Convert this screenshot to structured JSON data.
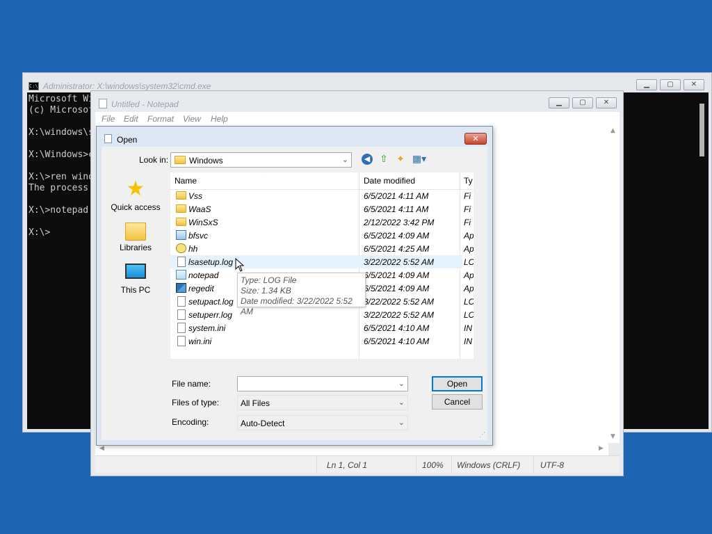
{
  "cmd": {
    "title": "Administrator: X:\\windows\\system32\\cmd.exe",
    "lines": [
      "Microsoft Wi",
      "(c) Microsof",
      "",
      "X:\\windows\\s",
      "",
      "X:\\Windows>c",
      "",
      "X:\\>ren wind",
      "The process",
      "",
      "X:\\>notepad",
      "",
      "X:\\>"
    ],
    "icon": "console-icon"
  },
  "notepad": {
    "title": "Untitled - Notepad",
    "menu": [
      "File",
      "Edit",
      "Format",
      "View",
      "Help"
    ],
    "status": {
      "position": "Ln 1, Col 1",
      "zoom": "100%",
      "line_ending": "Windows (CRLF)",
      "encoding": "UTF-8"
    }
  },
  "open_dialog": {
    "title": "Open",
    "look_in_label": "Look in:",
    "look_in_value": "Windows",
    "places": [
      {
        "label": "Quick access",
        "icon": "star-icon"
      },
      {
        "label": "Libraries",
        "icon": "libraries-folder-icon"
      },
      {
        "label": "This PC",
        "icon": "monitor-icon"
      }
    ],
    "columns": {
      "name": "Name",
      "date": "Date modified",
      "type": "Ty"
    },
    "files": [
      {
        "name": "Vss",
        "date": "6/5/2021 4:11 AM",
        "type": "Fi",
        "icon": "folder"
      },
      {
        "name": "WaaS",
        "date": "6/5/2021 4:11 AM",
        "type": "Fi",
        "icon": "folder"
      },
      {
        "name": "WinSxS",
        "date": "2/12/2022 3:42 PM",
        "type": "Fi",
        "icon": "folder"
      },
      {
        "name": "bfsvc",
        "date": "6/5/2021 4:09 AM",
        "type": "Ap",
        "icon": "app"
      },
      {
        "name": "hh",
        "date": "6/5/2021 4:25 AM",
        "type": "Ap",
        "icon": "help"
      },
      {
        "name": "lsasetup.log",
        "date": "3/22/2022 5:52 AM",
        "type": "LC",
        "icon": "doc"
      },
      {
        "name": "notepad",
        "date": "6/5/2021 4:09 AM",
        "type": "Ap",
        "icon": "notepad"
      },
      {
        "name": "regedit",
        "date": "6/5/2021 4:09 AM",
        "type": "Ap",
        "icon": "regedit"
      },
      {
        "name": "setupact.log",
        "date": "3/22/2022 5:52 AM",
        "type": "LC",
        "icon": "doc"
      },
      {
        "name": "setuperr.log",
        "date": "3/22/2022 5:52 AM",
        "type": "LC",
        "icon": "doc"
      },
      {
        "name": "system.ini",
        "date": "6/5/2021 4:10 AM",
        "type": "IN",
        "icon": "doc"
      },
      {
        "name": "win.ini",
        "date": "6/5/2021 4:10 AM",
        "type": "IN",
        "icon": "doc"
      }
    ],
    "tooltip": {
      "type": "Type: LOG File",
      "size": "Size: 1.34 KB",
      "modified": "Date modified: 3/22/2022 5:52 AM"
    },
    "file_name_label": "File name:",
    "file_name_value": "",
    "files_of_type_label": "Files of type:",
    "files_of_type_value": "All Files",
    "encoding_label": "Encoding:",
    "encoding_value": "Auto-Detect",
    "open_button": "Open",
    "cancel_button": "Cancel"
  }
}
